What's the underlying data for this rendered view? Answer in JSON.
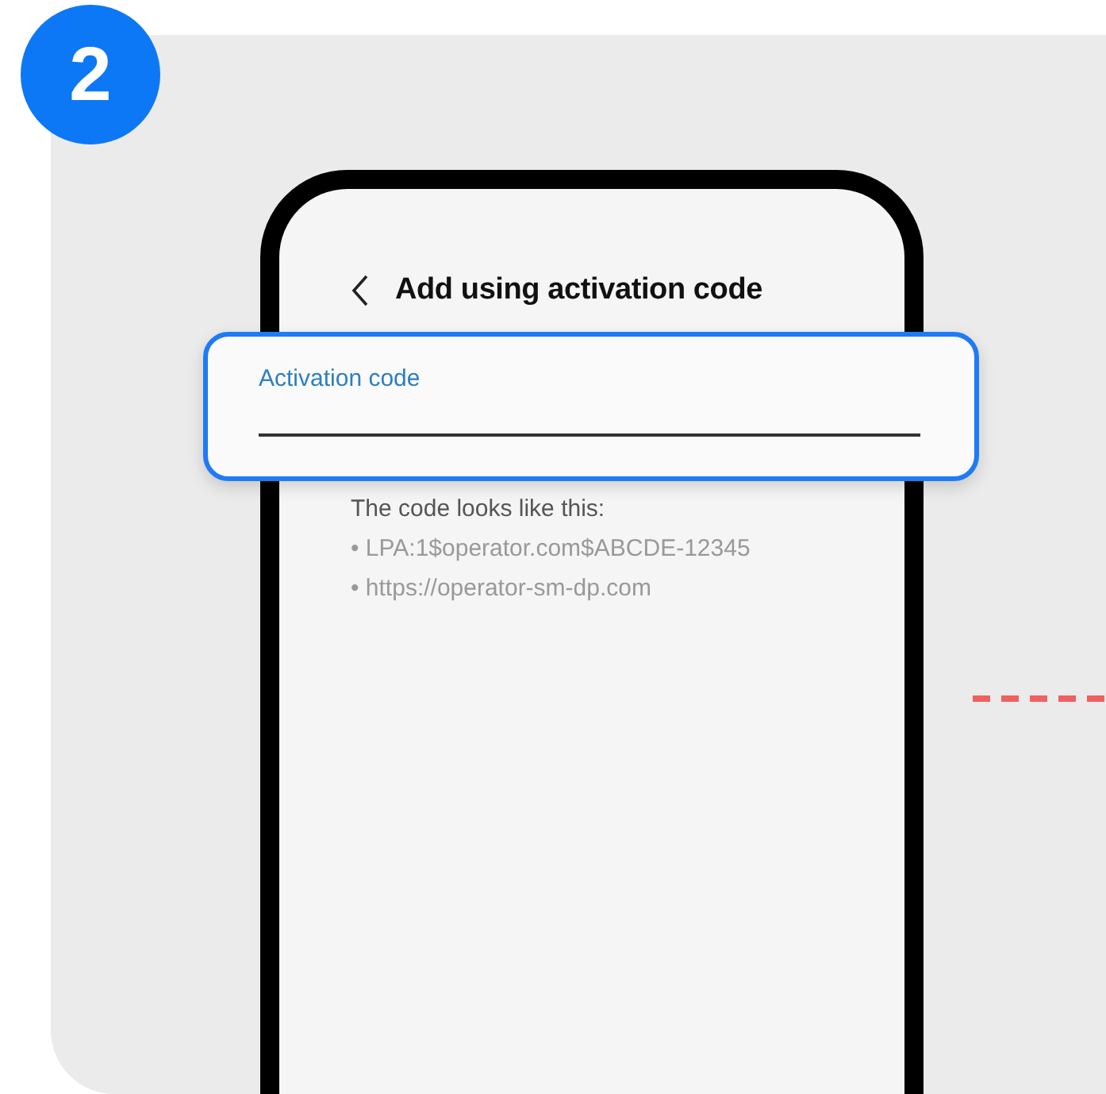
{
  "step_badge": "2",
  "screen": {
    "title": "Add using activation code",
    "field": {
      "label": "Activation code"
    },
    "hint": "The code looks like this:",
    "examples": [
      "• LPA:1$operator.com$ABCDE-12345",
      "• https://operator-sm-dp.com"
    ]
  }
}
